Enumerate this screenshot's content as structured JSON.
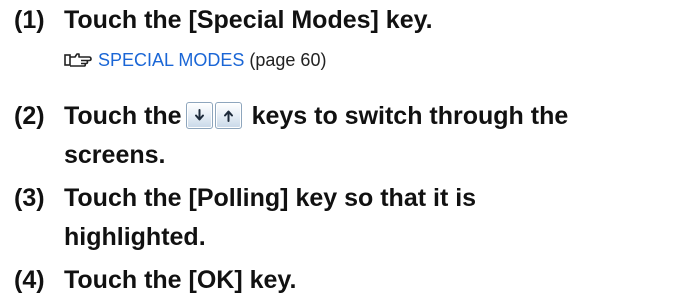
{
  "steps": [
    {
      "num": "(1)",
      "line1": "Touch the [Special Modes] key."
    },
    {
      "num": "(2)",
      "line1_before": "Touch the",
      "line1_after": "keys to switch through the",
      "line2": "screens."
    },
    {
      "num": "(3)",
      "line1": "Touch the [Polling] key so that it is",
      "line2": "highlighted."
    },
    {
      "num": "(4)",
      "line1": "Touch the [OK] key."
    }
  ],
  "reference": {
    "link_text": "SPECIAL MODES",
    "page_text": "(page 60)",
    "icon": "reference-hand-icon"
  },
  "keys": [
    {
      "icon": "arrow-down-icon"
    },
    {
      "icon": "arrow-up-icon"
    }
  ],
  "colors": {
    "link": "#1a66d6",
    "text": "#111111"
  }
}
